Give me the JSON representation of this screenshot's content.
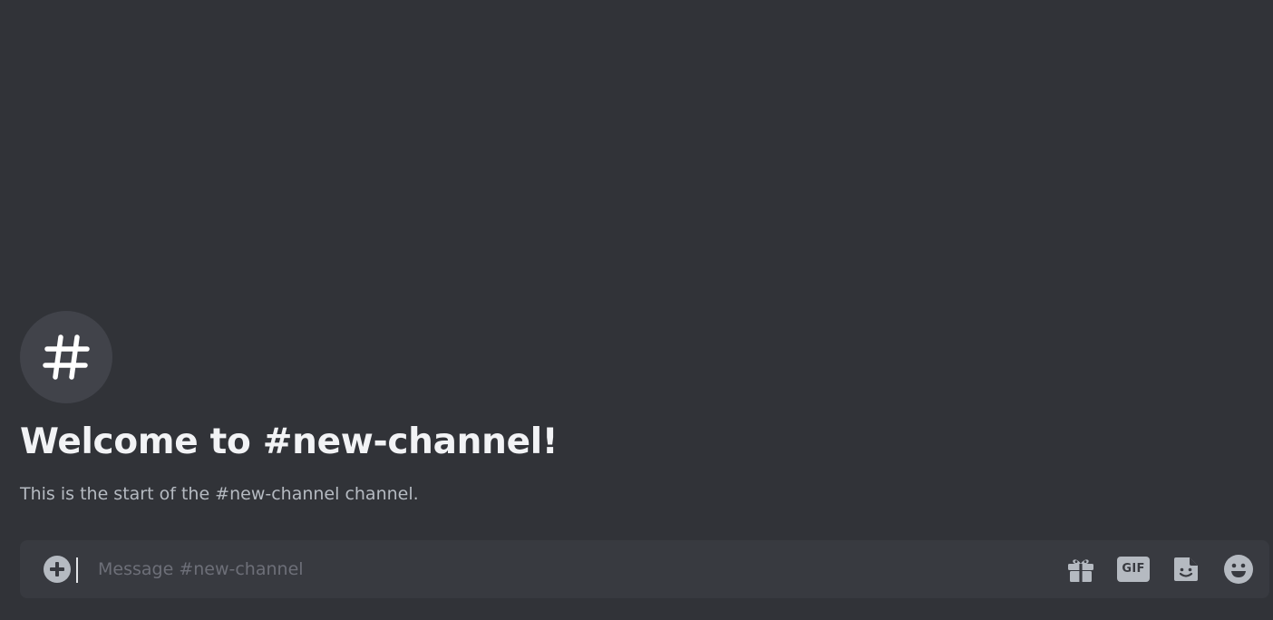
{
  "channel": {
    "icon": "hash-icon",
    "welcome_title": "Welcome to #new-channel!",
    "welcome_subtitle": "This is the start of the #new-channel channel."
  },
  "composer": {
    "placeholder": "Message #new-channel",
    "value": "",
    "attach_icon": "plus-circle-icon",
    "tools": {
      "gift_icon": "gift-icon",
      "gif_label": "GIF",
      "sticker_icon": "sticker-icon",
      "emoji_icon": "emoji-icon"
    }
  },
  "theme": {
    "background": "#313338",
    "composer_background": "#383a40",
    "title_color": "#f2f3f5",
    "muted_text": "#b5bac1",
    "placeholder_color": "#6d6f78"
  }
}
